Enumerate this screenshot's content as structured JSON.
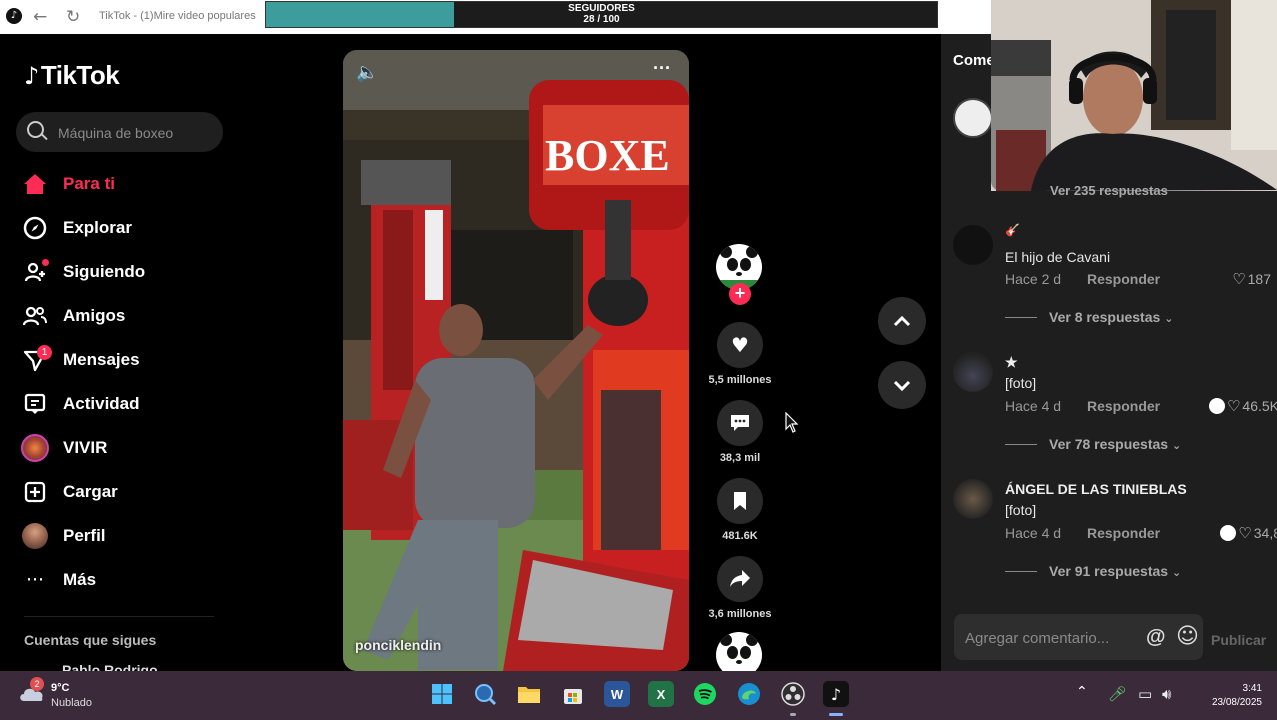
{
  "browser": {
    "tab_title": "TikTok - (1)Mire video populares",
    "followers_goal": {
      "label": "SEGUIDORES",
      "count_text": "28 / 100",
      "current": 28,
      "target": 100
    }
  },
  "sidebar": {
    "logo_text": "TikTok",
    "search_placeholder": "Máquina de boxeo",
    "items": [
      {
        "label": "Para ti",
        "icon": "home-icon",
        "active": true
      },
      {
        "label": "Explorar",
        "icon": "compass-icon"
      },
      {
        "label": "Siguiendo",
        "icon": "following-icon"
      },
      {
        "label": "Amigos",
        "icon": "friends-icon"
      },
      {
        "label": "Mensajes",
        "icon": "messages-icon",
        "badge": "1"
      },
      {
        "label": "Actividad",
        "icon": "activity-icon"
      },
      {
        "label": "VIVIR",
        "icon": "live-icon"
      },
      {
        "label": "Cargar",
        "icon": "upload-icon"
      },
      {
        "label": "Perfil",
        "icon": "profile-avatar"
      },
      {
        "label": "Más",
        "icon": "more-icon"
      }
    ],
    "following_heading": "Cuentas que sigues",
    "following_first": "Pablo Rodrigo"
  },
  "video": {
    "author": "ponciklendin",
    "sign_text": "BOXE",
    "actions": {
      "likes": "5,5 millones",
      "comments": "38,3 mil",
      "saves": "481.6K",
      "shares": "3,6 millones"
    }
  },
  "comments": {
    "heading": "Come",
    "hidden_replies_text": "Ver 235 respuestas",
    "items": [
      {
        "name": "El hijo de Cavani",
        "prefix": "🎸",
        "time": "Hace 2 d",
        "reply": "Responder",
        "likes": "187",
        "creator_liked": false,
        "view_replies": "Ver 8 respuestas"
      },
      {
        "name": "★",
        "text": "[foto]",
        "time": "Hace 4 d",
        "reply": "Responder",
        "likes": "46.5K",
        "creator_liked": true,
        "view_replies": "Ver 78 respuestas"
      },
      {
        "name": "ÁNGEL DE LAS TINIEBLAS",
        "text": "[foto]",
        "time": "Hace 4 d",
        "reply": "Responder",
        "likes": "34,8",
        "creator_liked": true,
        "view_replies": "Ver 91 respuestas"
      }
    ],
    "input_placeholder": "Agregar comentario...",
    "publish_label": "Publicar"
  },
  "taskbar": {
    "temperature": "9°C",
    "condition": "Nublado",
    "weather_badge": "2",
    "apps": [
      "windows-start-icon",
      "search-icon",
      "file-explorer-icon",
      "store-icon",
      "word-icon",
      "excel-icon",
      "spotify-icon",
      "edge-icon",
      "obs-icon",
      "tiktok-icon"
    ],
    "time": "3:41",
    "date": "23/08/2025"
  },
  "colors": {
    "accent": "#fe2c55",
    "followers_fill": "#3d9c9c",
    "taskbar": "#3b2a3a",
    "panel": "#1e1e1e"
  }
}
